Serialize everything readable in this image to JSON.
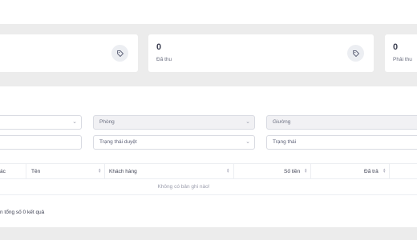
{
  "stats": [
    {
      "value": "",
      "label": "",
      "icon": "tag-icon"
    },
    {
      "value": "0",
      "label": "Đã thu",
      "icon": "tag-icon"
    },
    {
      "value": "0",
      "label": "Phải thu",
      "icon": "tag-icon"
    }
  ],
  "filters": {
    "row1": [
      {
        "value": "",
        "placeholder": ""
      },
      {
        "value": "Phòng"
      },
      {
        "value": "Giường"
      }
    ],
    "row2": [
      {
        "value": ""
      },
      {
        "value": "Trạng thái duyệt"
      },
      {
        "value": "Trạng thái"
      }
    ]
  },
  "table": {
    "columns": [
      "ác",
      "Tên",
      "Khách hàng",
      "Số tiền",
      "Đã trả"
    ],
    "empty_message": "Không có bản ghi nào!"
  },
  "summary": "n tổng số 0 kết quả"
}
